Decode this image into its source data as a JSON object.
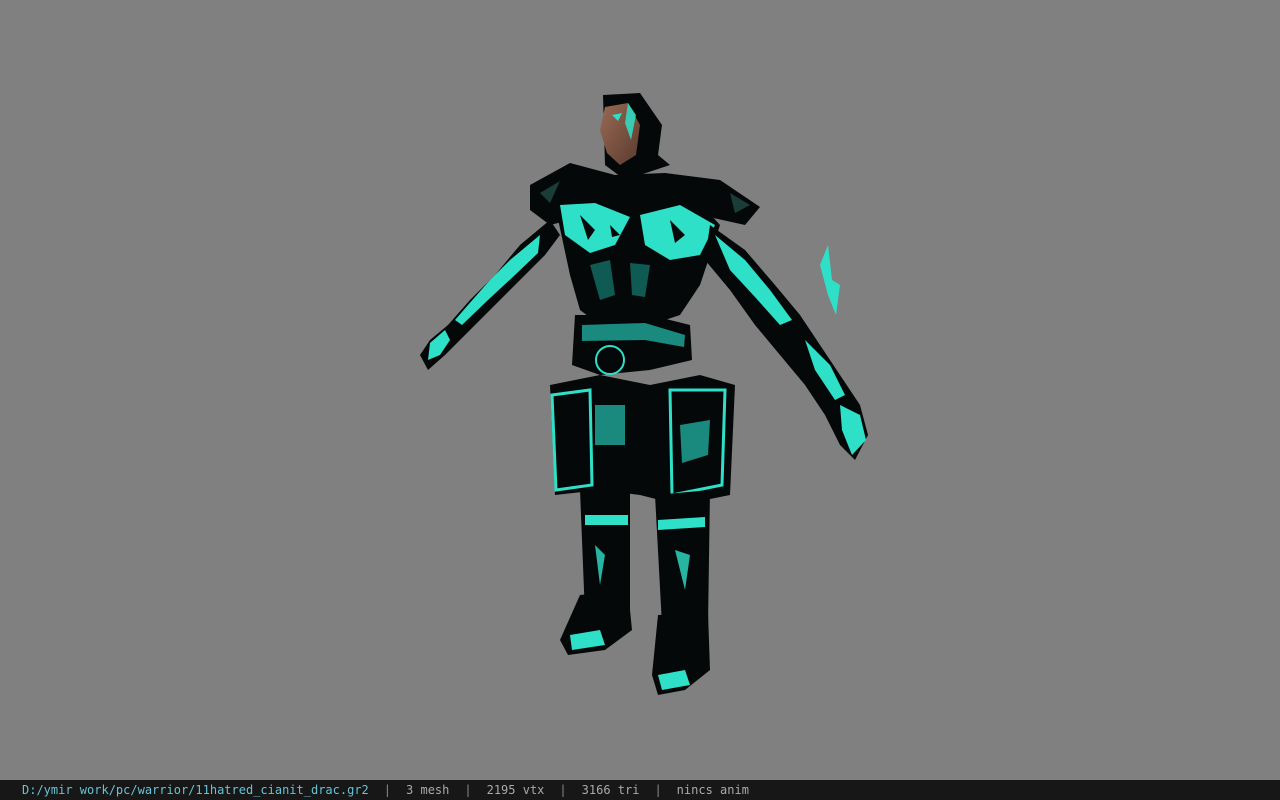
{
  "viewer": {
    "background_color": "#808080",
    "model": {
      "icon": "character-model",
      "armor_glow_color": "#2fe0c8",
      "armor_dark_color": "#050808"
    }
  },
  "status_bar": {
    "file_path": "D:/ymir work/pc/warrior/11hatred_cianit_drac.gr2",
    "separator": "|",
    "mesh": "3 mesh",
    "vertices": "2195 vtx",
    "triangles": "3166 tri",
    "animation": "nincs anim"
  }
}
